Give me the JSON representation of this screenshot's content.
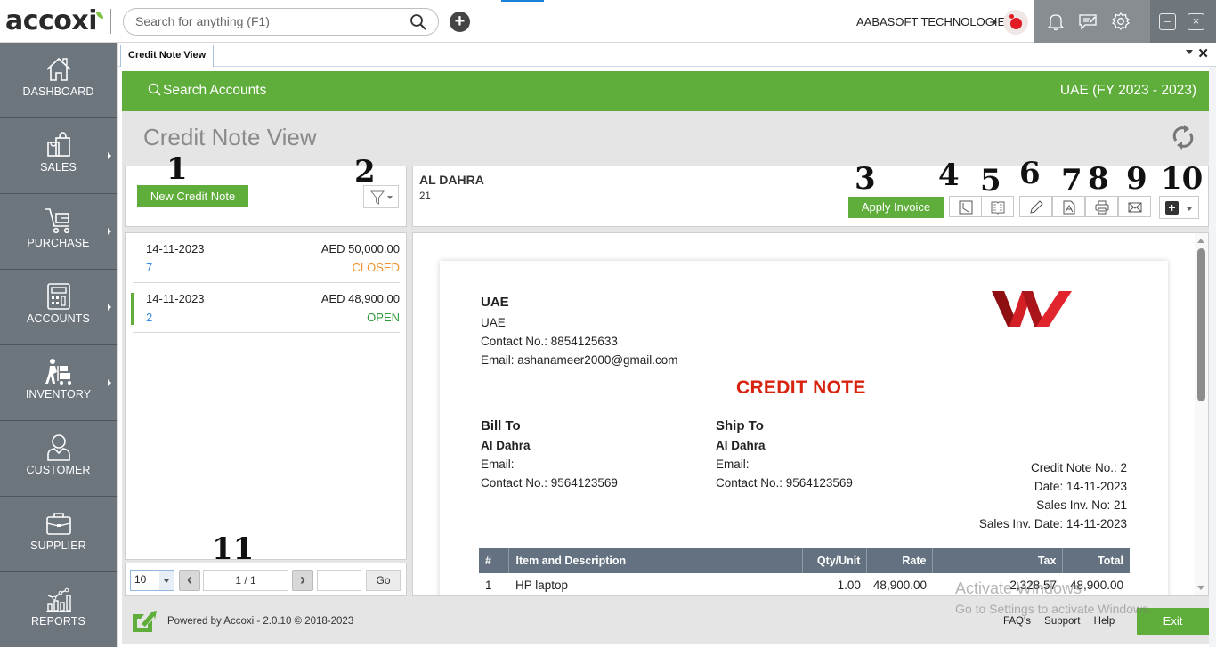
{
  "app": {
    "logo_text": "accoxi",
    "search_placeholder": "Search for anything (F1)",
    "company": "AABASOFT TECHNOLOGIES"
  },
  "sidebar": {
    "items": [
      {
        "label": "DASHBOARD",
        "icon": "home-icon",
        "has_submenu": false
      },
      {
        "label": "SALES",
        "icon": "shopping-bag-icon",
        "has_submenu": true
      },
      {
        "label": "PURCHASE",
        "icon": "cart-icon",
        "has_submenu": true
      },
      {
        "label": "ACCOUNTS",
        "icon": "calculator-icon",
        "has_submenu": true
      },
      {
        "label": "INVENTORY",
        "icon": "worker-trolley-icon",
        "has_submenu": true
      },
      {
        "label": "CUSTOMER",
        "icon": "user-icon",
        "has_submenu": false
      },
      {
        "label": "SUPPLIER",
        "icon": "briefcase-icon",
        "has_submenu": false
      },
      {
        "label": "REPORTS",
        "icon": "chart-icon",
        "has_submenu": false
      }
    ]
  },
  "tabs": [
    {
      "label": "Credit Note View",
      "active": true
    }
  ],
  "greenbar": {
    "search_accounts": "Search Accounts",
    "fiscal_year": "UAE (FY 2023 - 2023)"
  },
  "page": {
    "title": "Credit Note View"
  },
  "left_panel": {
    "new_button": "New Credit Note",
    "notes": [
      {
        "date": "14-11-2023",
        "amount": "AED 50,000.00",
        "number": "7",
        "status": "CLOSED",
        "status_color": "#f0932b",
        "selected": false
      },
      {
        "date": "14-11-2023",
        "amount": "AED 48,900.00",
        "number": "2",
        "status": "OPEN",
        "status_color": "#2e9a3e",
        "selected": true
      }
    ],
    "pager": {
      "page_size": "10",
      "page_info": "1 / 1",
      "goto_value": "",
      "go_label": "Go"
    }
  },
  "detail_header": {
    "customer": "AL DAHRA",
    "invoice_ref": "21",
    "apply_invoice": "Apply Invoice"
  },
  "callouts": [
    "1",
    "2",
    "3",
    "4",
    "5",
    "6",
    "7",
    "8",
    "9",
    "10",
    "11"
  ],
  "document": {
    "company_name": "UAE",
    "company_address": "UAE",
    "company_contact": "Contact No.: 8854125633",
    "company_email": "Email: ashanameer2000@gmail.com",
    "title": "CREDIT NOTE",
    "bill_to": {
      "heading": "Bill To",
      "name": "Al Dahra",
      "email": "Email:",
      "contact": "Contact No.: 9564123569"
    },
    "ship_to": {
      "heading": "Ship To",
      "name": "Al Dahra",
      "email": "Email:",
      "contact": "Contact No.: 9564123569"
    },
    "meta": {
      "credit_note_no": "Credit Note No.: 2",
      "date": "Date: 14-11-2023",
      "sales_inv_no": "Sales Inv. No: 21",
      "sales_inv_date": "Sales Inv. Date: 14-11-2023"
    },
    "table": {
      "headers": [
        "#",
        "Item and Description",
        "Qty/Unit",
        "Rate",
        "Tax",
        "Total"
      ],
      "rows": [
        [
          "1",
          "HP laptop",
          "1.00",
          "48,900.00",
          "2,328.57",
          "48,900.00"
        ]
      ]
    },
    "brand_color": "#d8230f"
  },
  "footer": {
    "powered_by": "Powered by Accoxi - 2.0.10 © 2018-2023",
    "links": [
      "FAQ's",
      "Support",
      "Help"
    ],
    "exit_label": "Exit"
  },
  "watermark": {
    "line1": "Activate Windows",
    "line2": "Go to Settings to activate Windows."
  },
  "colors": {
    "accent_green": "#5fae3b",
    "sidebar_bg": "#6d757d",
    "table_header": "#637180"
  }
}
